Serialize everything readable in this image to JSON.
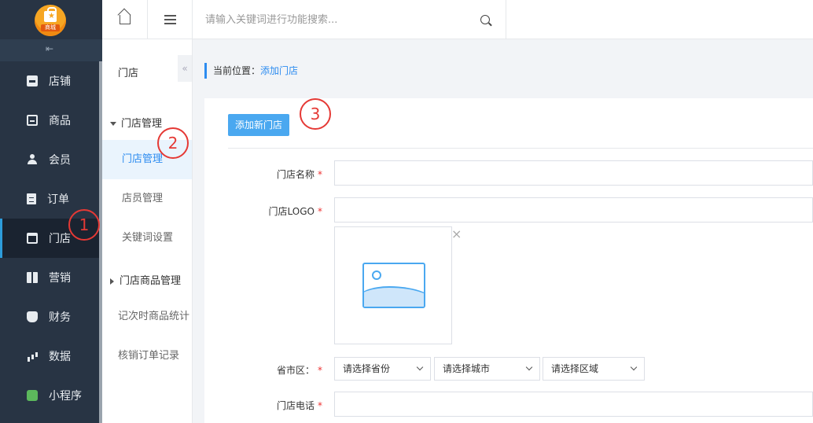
{
  "logo": {
    "text": "商城"
  },
  "sidebar": {
    "items": [
      {
        "label": "店铺",
        "icon": "shop-icon"
      },
      {
        "label": "商品",
        "icon": "goods-icon"
      },
      {
        "label": "会员",
        "icon": "user-icon"
      },
      {
        "label": "订单",
        "icon": "order-icon"
      },
      {
        "label": "门店",
        "icon": "store-icon",
        "active": true
      },
      {
        "label": "营销",
        "icon": "gift-icon"
      },
      {
        "label": "财务",
        "icon": "money-bag-icon"
      },
      {
        "label": "数据",
        "icon": "bar-chart-icon"
      },
      {
        "label": "小程序",
        "icon": "mini-program-icon"
      }
    ]
  },
  "subnav": {
    "title": "门店",
    "group1": "门店管理",
    "items1": [
      "门店管理",
      "店员管理",
      "关键词设置"
    ],
    "group2": "门店商品管理",
    "items2": [
      "记次时商品统计",
      "核销订单记录"
    ]
  },
  "topbar": {
    "search_placeholder": "请输入关键词进行功能搜索..."
  },
  "breadcrumb": {
    "prefix": "当前位置：",
    "current": "添加门店"
  },
  "form": {
    "add_button": "添加新门店",
    "name_label": "门店名称",
    "logo_label": "门店LOGO",
    "region_label": "省市区：",
    "province_placeholder": "请选择省份",
    "city_placeholder": "请选择城市",
    "district_placeholder": "请选择区域",
    "phone_label": "门店电话",
    "required_mark": "*",
    "remove_mark": "×"
  },
  "annotations": [
    "1",
    "2",
    "3"
  ],
  "colors": {
    "sidebar_bg": "#283444",
    "accent": "#2d8cf0",
    "button": "#4aa8f0",
    "annotation": "#e53935"
  }
}
